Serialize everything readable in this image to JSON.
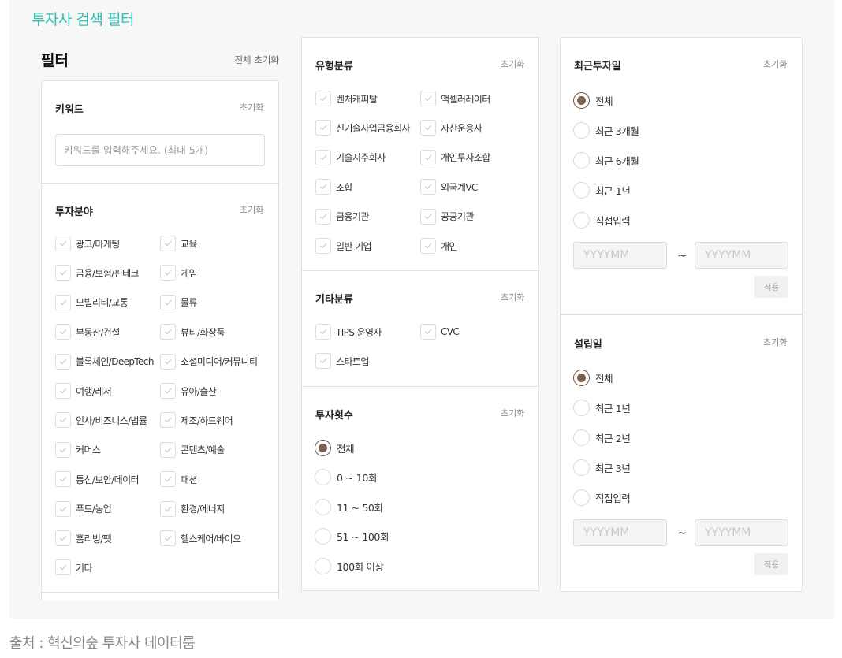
{
  "page": {
    "title": "투자사 검색 필터",
    "source": "출처 : 혁신의숲 투자사 데이터룸"
  },
  "filter": {
    "title": "필터",
    "reset_all": "전체 초기화"
  },
  "reset_label": "초기화",
  "keyword": {
    "title": "키워드",
    "placeholder": "키워드를 입력해주세요. (최대 5개)"
  },
  "investment_field": {
    "title": "투자분야",
    "items": [
      "광고/마케팅",
      "교육",
      "금융/보험/핀테크",
      "게임",
      "모빌리티/교통",
      "물류",
      "부동산/건설",
      "뷰티/화장품",
      "블록체인/DeepTech",
      "소셜미디어/커뮤니티",
      "여행/레저",
      "유아/출산",
      "인사/비즈니스/법률",
      "제조/하드웨어",
      "커머스",
      "콘텐츠/예술",
      "통신/보안/데이터",
      "패션",
      "푸드/농업",
      "환경/에너지",
      "홈리빙/펫",
      "헬스케어/바이오",
      "기타"
    ]
  },
  "type_category": {
    "title": "유형분류",
    "items": [
      "벤처캐피탈",
      "액셀러레이터",
      "신기술사업금융회사",
      "자산운용사",
      "기술지주회사",
      "개인투자조합",
      "조합",
      "외국계VC",
      "금융기관",
      "공공기관",
      "일반 기업",
      "개인"
    ]
  },
  "other_category": {
    "title": "기타분류",
    "items": [
      "TIPS 운영사",
      "CVC",
      "스타트업"
    ]
  },
  "investment_count": {
    "title": "투자횟수",
    "options": [
      "전체",
      "0 ~ 10회",
      "11 ~ 50회",
      "51 ~ 100회",
      "100회 이상"
    ],
    "selected": "전체"
  },
  "recent_investment": {
    "title": "최근투자일",
    "options": [
      "전체",
      "최근 3개월",
      "최근 6개월",
      "최근 1년",
      "직접입력"
    ],
    "selected": "전체",
    "from_placeholder": "YYYYMM",
    "tilde": "~",
    "to_placeholder": "YYYYMM",
    "apply": "적용"
  },
  "founded": {
    "title": "설립일",
    "options": [
      "전체",
      "최근 1년",
      "최근 2년",
      "최근 3년",
      "직접입력"
    ],
    "selected": "전체",
    "from_placeholder": "YYYYMM",
    "tilde": "~",
    "to_placeholder": "YYYYMM",
    "apply": "적용"
  },
  "colors": {
    "title_accent": "#2cc2b7",
    "radio_selected": "#7a6150",
    "background": "#f7f7f6"
  }
}
